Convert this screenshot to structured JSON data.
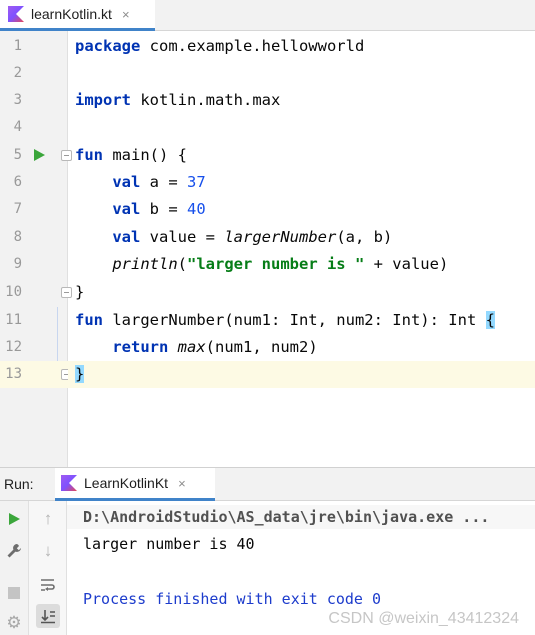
{
  "editor": {
    "tab": {
      "label": "learnKotlin.kt",
      "close": "×"
    },
    "line_numbers": [
      "1",
      "2",
      "3",
      "4",
      "5",
      "6",
      "7",
      "8",
      "9",
      "10",
      "11",
      "12",
      "13"
    ],
    "lines": {
      "l1": {
        "kw": "package",
        "rest": " com.example.hellowworld"
      },
      "l3": {
        "kw": "import",
        "rest": " kotlin.math.max"
      },
      "l5": {
        "kw": "fun",
        "rest": " main() {"
      },
      "l6": {
        "indent": "    ",
        "kw": "val",
        "mid": " a = ",
        "num": "37"
      },
      "l7": {
        "indent": "    ",
        "kw": "val",
        "mid": " b = ",
        "num": "40"
      },
      "l8": {
        "indent": "    ",
        "kw": "val",
        "mid": " value = ",
        "fn": "largerNumber",
        "rest": "(a, b)"
      },
      "l9": {
        "indent": "    ",
        "fn": "println",
        "open": "(",
        "str": "\"larger number is \"",
        "rest": " + value)"
      },
      "l10": {
        "text": "}"
      },
      "l11": {
        "kw": "fun",
        "rest": " largerNumber(num1: Int, num2: Int): Int ",
        "brace": "{"
      },
      "l12": {
        "indent": "    ",
        "kw": "return",
        "sp": " ",
        "fn": "max",
        "rest": "(num1, num2)"
      },
      "l13": {
        "brace": "}"
      }
    }
  },
  "run_panel": {
    "title": "Run:",
    "tab": {
      "label": "LearnKotlinKt",
      "close": "×"
    },
    "console": {
      "path": "D:\\AndroidStudio\\AS_data\\jre\\bin\\java.exe ...",
      "output": "larger number is 40",
      "exit": "Process finished with exit code 0"
    },
    "toolbar_icons": [
      "run-icon",
      "wrench-icon",
      "stop-icon",
      "settings-icon",
      "up-arrow-icon",
      "down-arrow-icon",
      "soft-wrap-icon",
      "scroll-to-end-icon"
    ]
  },
  "watermark": "CSDN @weixin_43412324",
  "colors": {
    "keyword": "#0033b3",
    "number": "#1750eb",
    "string": "#067d17",
    "current_line": "#fdfae4",
    "brace_highlight": "#93d9ff",
    "run_green": "#3ba63b",
    "exit_text": "#1d3ccc"
  }
}
